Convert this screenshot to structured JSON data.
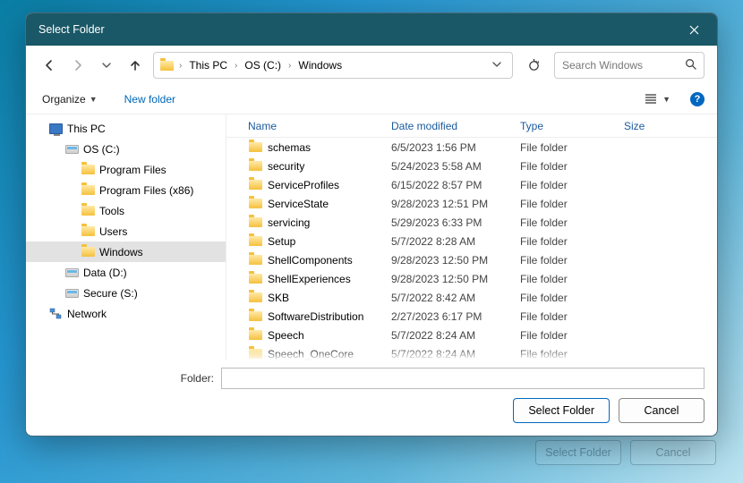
{
  "window": {
    "title": "Select Folder"
  },
  "nav": {
    "breadcrumb": [
      {
        "label": "This PC"
      },
      {
        "label": "OS (C:)"
      },
      {
        "label": "Windows"
      }
    ],
    "search_placeholder": "Search Windows"
  },
  "toolbar": {
    "organize_label": "Organize",
    "newfolder_label": "New folder"
  },
  "tree": [
    {
      "label": "This PC",
      "icon": "thispc",
      "indent": 20
    },
    {
      "label": "OS (C:)",
      "icon": "drive",
      "indent": 38
    },
    {
      "label": "Program Files",
      "icon": "folder",
      "indent": 56
    },
    {
      "label": "Program Files (x86)",
      "icon": "folder",
      "indent": 56
    },
    {
      "label": "Tools",
      "icon": "folder",
      "indent": 56
    },
    {
      "label": "Users",
      "icon": "folder",
      "indent": 56
    },
    {
      "label": "Windows",
      "icon": "folder",
      "indent": 56,
      "selected": true
    },
    {
      "label": "Data (D:)",
      "icon": "drive",
      "indent": 38
    },
    {
      "label": "Secure (S:)",
      "icon": "drive",
      "indent": 38
    },
    {
      "label": "Network",
      "icon": "network",
      "indent": 20
    }
  ],
  "columns": {
    "name": "Name",
    "date": "Date modified",
    "type": "Type",
    "size": "Size"
  },
  "files": [
    {
      "name": "schemas",
      "date": "6/5/2023 1:56 PM",
      "type": "File folder"
    },
    {
      "name": "security",
      "date": "5/24/2023 5:58 AM",
      "type": "File folder"
    },
    {
      "name": "ServiceProfiles",
      "date": "6/15/2022 8:57 PM",
      "type": "File folder"
    },
    {
      "name": "ServiceState",
      "date": "9/28/2023 12:51 PM",
      "type": "File folder"
    },
    {
      "name": "servicing",
      "date": "5/29/2023 6:33 PM",
      "type": "File folder"
    },
    {
      "name": "Setup",
      "date": "5/7/2022 8:28 AM",
      "type": "File folder"
    },
    {
      "name": "ShellComponents",
      "date": "9/28/2023 12:50 PM",
      "type": "File folder"
    },
    {
      "name": "ShellExperiences",
      "date": "9/28/2023 12:50 PM",
      "type": "File folder"
    },
    {
      "name": "SKB",
      "date": "5/7/2022 8:42 AM",
      "type": "File folder"
    },
    {
      "name": "SoftwareDistribution",
      "date": "2/27/2023 6:17 PM",
      "type": "File folder"
    },
    {
      "name": "Speech",
      "date": "5/7/2022 8:24 AM",
      "type": "File folder"
    },
    {
      "name": "Speech_OneCore",
      "date": "5/7/2022 8:24 AM",
      "type": "File folder"
    }
  ],
  "footer": {
    "folder_label": "Folder:",
    "folder_value": "",
    "select_label": "Select Folder",
    "cancel_label": "Cancel"
  }
}
